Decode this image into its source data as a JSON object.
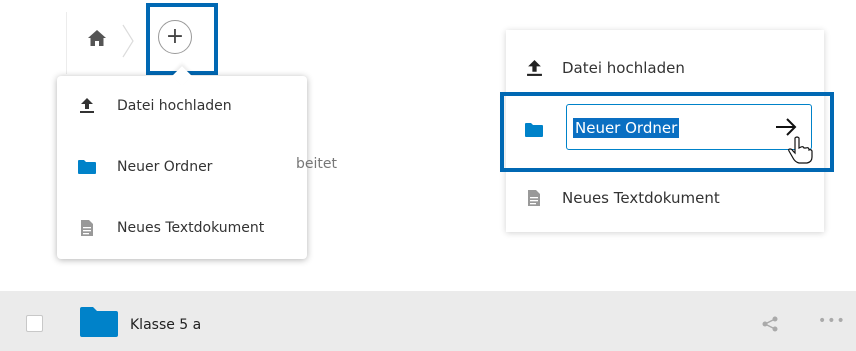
{
  "breadcrumb": {
    "home_icon": "home-icon",
    "separator_icon": "chevron-right-icon"
  },
  "new_button": {
    "symbol": "+",
    "icon": "plus-icon"
  },
  "new_menu_left": {
    "items": [
      {
        "icon": "upload-icon",
        "label": "Datei hochladen"
      },
      {
        "icon": "folder-icon",
        "label": "Neuer Ordner"
      },
      {
        "icon": "document-icon",
        "label": "Neues Textdokument"
      }
    ]
  },
  "background_fragment": "beitet",
  "new_menu_right": {
    "upload_label": "Datei hochladen",
    "folder_input_value": "Neuer Ordner",
    "text_document_label": "Neues Textdokument"
  },
  "file_row": {
    "name": "Klasse 5 a",
    "share_icon": "share-icon",
    "more_icon": "more-icon",
    "more_symbol": "•••"
  },
  "colors": {
    "accent": "#0082c9",
    "highlight_border": "#0068b3",
    "folder": "#0082c9",
    "selection": "#0a6fc2",
    "row_bg": "#ebebeb"
  }
}
